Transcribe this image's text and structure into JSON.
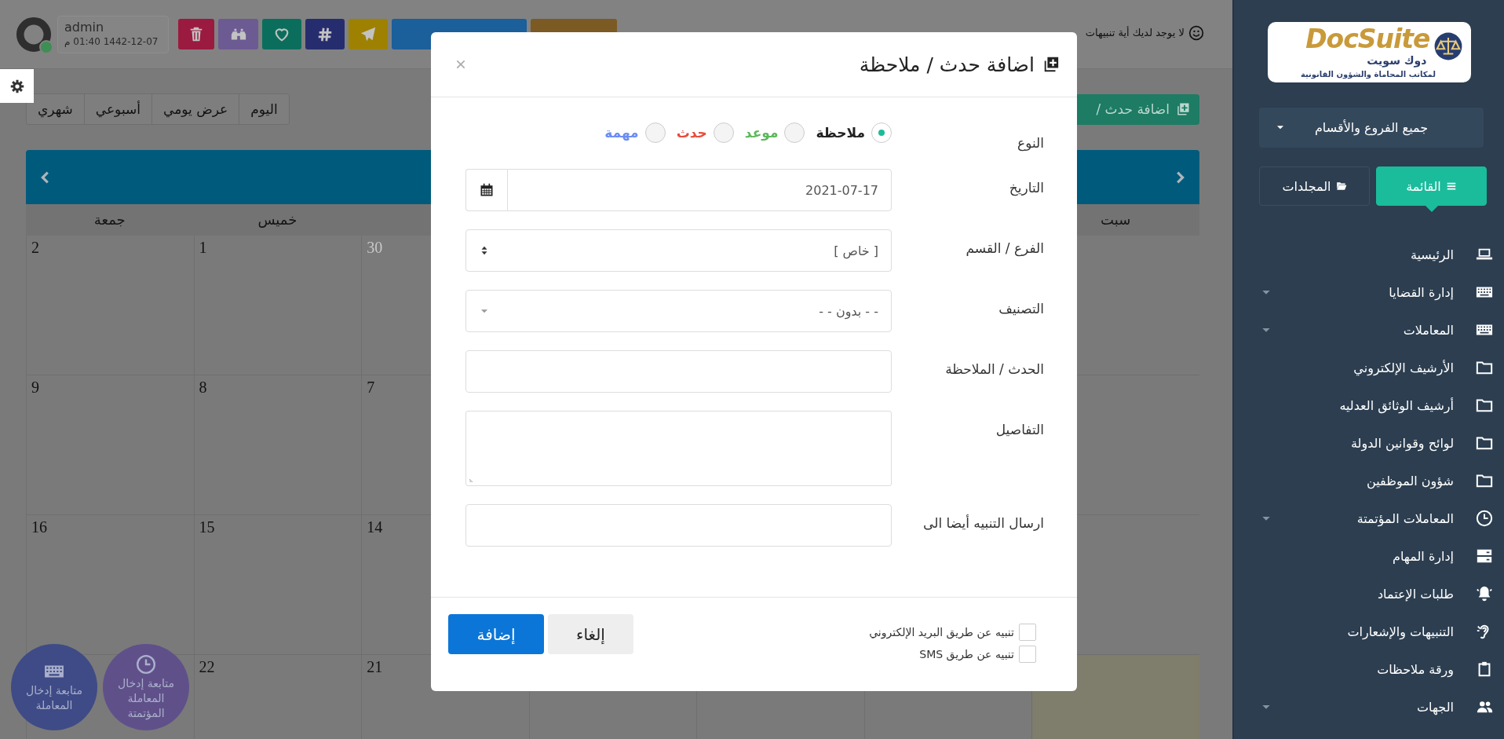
{
  "header": {
    "user": {
      "name": "admin",
      "datetime": "1442-12-07 01:40 م",
      "online": true
    },
    "toolbar": [
      {
        "kind": "trash",
        "color": "#9b1a3f"
      },
      {
        "kind": "binoculars",
        "color": "#6c5a93"
      },
      {
        "kind": "heart",
        "color": "#0b6e5d"
      },
      {
        "kind": "hashtag",
        "color": "#262d6e"
      },
      {
        "kind": "send",
        "color": "#9e8100"
      },
      {
        "kind": "wide",
        "color": "#1b5f9b"
      },
      {
        "kind": "medium",
        "color": "#7c5a24"
      }
    ],
    "notice": "لا يوجد لديك أية تنبيهات"
  },
  "view_buttons": [
    {
      "label": "اليوم",
      "selected": false
    },
    {
      "label": "عرض يومي",
      "selected": false
    },
    {
      "label": "أسبوعي",
      "selected": false
    },
    {
      "label": "شهري",
      "selected": false
    }
  ],
  "add_button": "اضافة حدث /",
  "calendar": {
    "weekdays": [
      {
        "label": "سبت"
      },
      {
        "label": "خميس"
      },
      {
        "label": "جمعة"
      }
    ],
    "weeks": [
      {
        "days": [
          {
            "label": "30",
            "other_month": true
          },
          {
            "label": "1",
            "other_month": false
          },
          {
            "label": "2",
            "other_month": false
          }
        ]
      },
      {
        "days": [
          {
            "label": "7",
            "other_month": false
          },
          {
            "label": "8",
            "other_month": false
          },
          {
            "label": "9",
            "other_month": false
          }
        ]
      },
      {
        "days": [
          {
            "label": "14",
            "other_month": false
          },
          {
            "label": "15",
            "other_month": false
          },
          {
            "label": "16",
            "other_month": false
          }
        ]
      },
      {
        "today_highlight": true,
        "days": [
          {
            "label": "21",
            "other_month": false
          },
          {
            "label": "22",
            "other_month": false
          }
        ]
      }
    ]
  },
  "shortcuts": [
    {
      "kind": "clock",
      "label": "متابعة إدخال المعاملة المؤتمتة",
      "color": "#60508a"
    },
    {
      "kind": "keyboard",
      "label": "متابعة إدخال المعاملة",
      "color": "#3e4b86"
    }
  ],
  "modal": {
    "title": "اضافة حدث / ملاحظة",
    "fields": [
      {
        "kind": "radio",
        "label": "النوع",
        "options": [
          {
            "label": "ملاحظة",
            "selected": true,
            "color": "#222222"
          },
          {
            "label": "موعد",
            "selected": false,
            "color": "#5cb85c"
          },
          {
            "label": "حدث",
            "selected": false,
            "color": "#e74c3c"
          },
          {
            "label": "مهمة",
            "selected": false,
            "color": "#6c8cf5"
          }
        ]
      },
      {
        "kind": "date",
        "label": "التاريخ",
        "value": "2021-07-17"
      },
      {
        "kind": "select",
        "label": "الفرع / القسم",
        "value": "[ خاص ]"
      },
      {
        "kind": "dropdown",
        "label": "التصنيف",
        "value": "- - بدون - -"
      },
      {
        "kind": "text",
        "label": "الحدث / الملاحظة"
      },
      {
        "kind": "textarea",
        "label": "التفاصيل"
      },
      {
        "kind": "text",
        "label": "ارسال التنبيه أيضا الى"
      }
    ],
    "checkboxes": [
      {
        "label": "تنبيه عن طريق البريد الإلكتروني",
        "checked": false
      },
      {
        "label": "تنبيه عن طريق SMS",
        "checked": false
      }
    ],
    "buttons": [
      {
        "kind": "secondary",
        "label": "إلغاء"
      },
      {
        "kind": "primary",
        "label": "إضافة"
      }
    ]
  },
  "sidebar": {
    "logo": {
      "latin": "DocSuite",
      "arabic": "دوك سويت",
      "tagline": "لمكاتب المحاماة والشؤون القانونية"
    },
    "branch_select": "جميع الفروع والأقسام",
    "tabs": [
      {
        "kind": "list",
        "label": "القائمة",
        "selected": true
      },
      {
        "kind": "folders",
        "label": "المجلدات",
        "selected": false
      }
    ],
    "menu": [
      {
        "kind": "laptop",
        "label": "الرئيسية",
        "expandable": false
      },
      {
        "kind": "keyboard",
        "label": "إدارة القضايا",
        "expandable": true
      },
      {
        "kind": "keyboard",
        "label": "المعاملات",
        "expandable": true
      },
      {
        "kind": "folder",
        "label": "الأرشيف الإلكتروني",
        "expandable": false
      },
      {
        "kind": "folder",
        "label": "أرشيف الوثائق العدليه",
        "expandable": false
      },
      {
        "kind": "folder",
        "label": "لوائح وقوانين الدولة",
        "expandable": false
      },
      {
        "kind": "folder",
        "label": "شؤون الموظفين",
        "expandable": false
      },
      {
        "kind": "clock",
        "label": "المعاملات المؤتمتة",
        "expandable": true
      },
      {
        "kind": "server",
        "label": "إدارة المهام",
        "expandable": false
      },
      {
        "kind": "bell",
        "label": "طلبات الإعتماد",
        "expandable": false
      },
      {
        "kind": "ear",
        "label": "التنبيهات والإشعارات",
        "expandable": false
      },
      {
        "kind": "clipboard",
        "label": "ورقة ملاحظات",
        "expandable": false
      },
      {
        "kind": "users",
        "label": "الجهات",
        "expandable": true
      }
    ]
  }
}
